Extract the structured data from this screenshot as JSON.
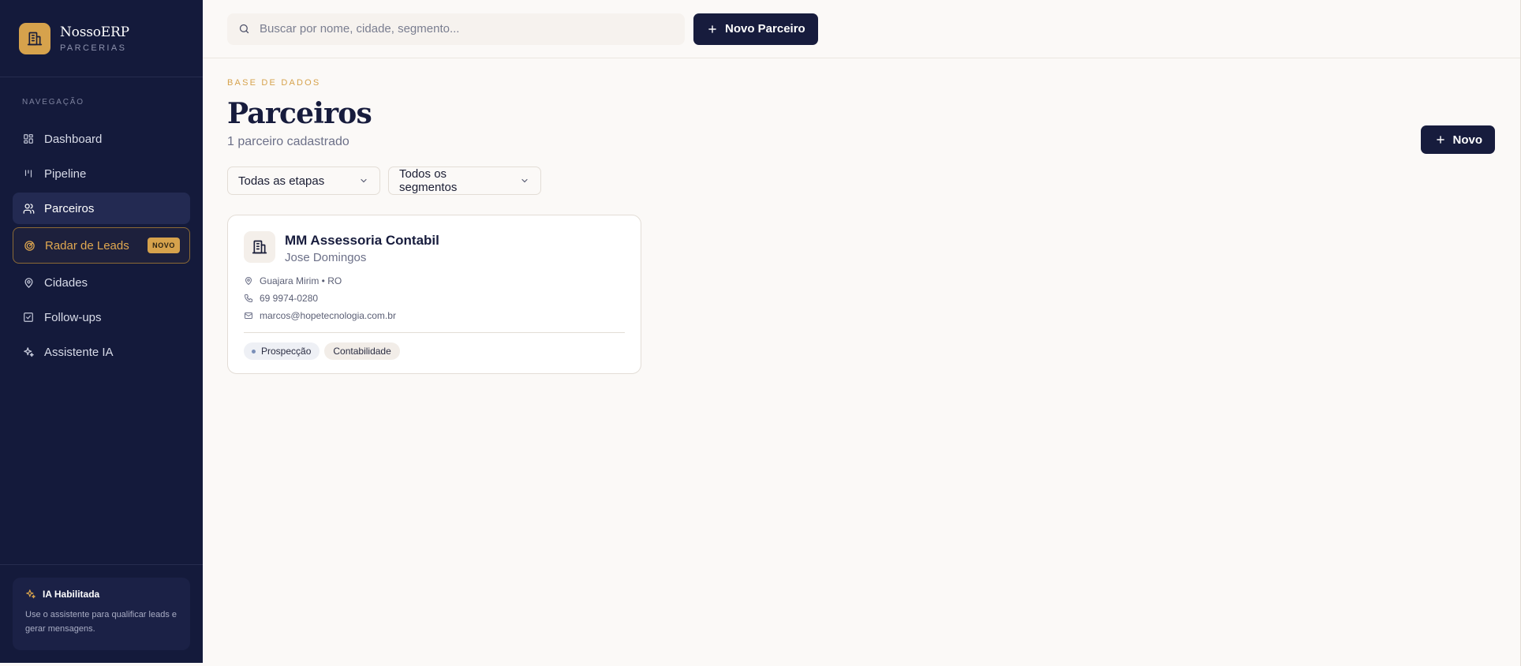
{
  "brand": {
    "name": "NossoERP",
    "subtitle": "PARCERIAS"
  },
  "nav": {
    "heading": "NAVEGAÇÃO",
    "items": [
      {
        "label": "Dashboard",
        "icon": "grid-icon"
      },
      {
        "label": "Pipeline",
        "icon": "kanban-icon"
      },
      {
        "label": "Parceiros",
        "icon": "users-icon",
        "active": true
      },
      {
        "label": "Radar de Leads",
        "icon": "radar-icon",
        "badge": "NOVO"
      },
      {
        "label": "Cidades",
        "icon": "map-pin-icon"
      },
      {
        "label": "Follow-ups",
        "icon": "check-square-icon"
      },
      {
        "label": "Assistente IA",
        "icon": "sparkles-icon"
      }
    ]
  },
  "ia_card": {
    "title": "IA Habilitada",
    "description": "Use o assistente para qualificar leads e gerar mensagens."
  },
  "topbar": {
    "search_placeholder": "Buscar por nome, cidade, segmento...",
    "new_partner_label": "Novo Parceiro"
  },
  "page": {
    "eyebrow": "BASE DE DADOS",
    "title": "Parceiros",
    "subtitle": "1 parceiro cadastrado",
    "new_label": "Novo"
  },
  "filters": {
    "stage_selected": "Todas as etapas",
    "segment_selected": "Todos os segmentos"
  },
  "partners": [
    {
      "name": "MM Assessoria Contabil",
      "contact": "Jose Domingos",
      "location": "Guajara Mirim • RO",
      "phone": "69 9974-0280",
      "email": "marcos@hopetecnologia.com.br",
      "stage": "Prospecção",
      "segment": "Contabilidade"
    }
  ],
  "colors": {
    "sidebar_bg": "#141a3b",
    "accent_gold": "#d6a24c",
    "primary_dark": "#171c3d",
    "page_bg": "#fbf9f7"
  }
}
